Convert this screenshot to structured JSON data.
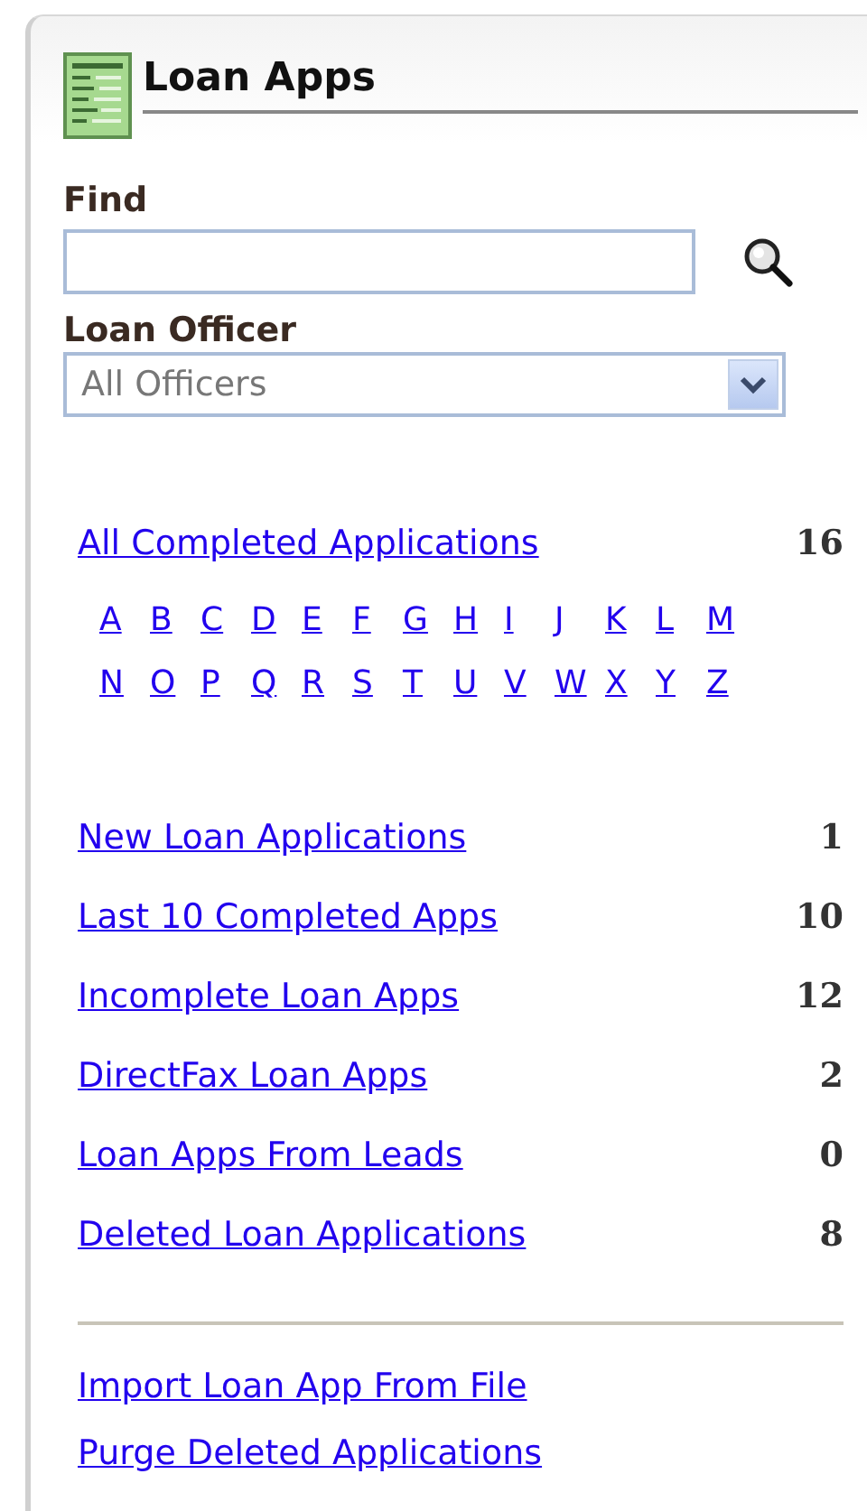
{
  "panel": {
    "title": "Loan Apps"
  },
  "find": {
    "label": "Find"
  },
  "loan_officer": {
    "label": "Loan Officer",
    "value": "All Officers"
  },
  "all_completed": {
    "label": "All Completed Applications",
    "count": "16"
  },
  "letters": [
    [
      "A",
      "B",
      "C",
      "D",
      "E",
      "F",
      "G",
      "H",
      "I",
      "J",
      "K",
      "L",
      "M"
    ],
    [
      "N",
      "O",
      "P",
      "Q",
      "R",
      "S",
      "T",
      "U",
      "V",
      "W",
      "X",
      "Y",
      "Z"
    ]
  ],
  "lists": [
    {
      "label": "New Loan Applications",
      "count": "1"
    },
    {
      "label": "Last 10 Completed Apps",
      "count": "10"
    },
    {
      "label": "Incomplete Loan Apps",
      "count": "12"
    },
    {
      "label": "DirectFax Loan Apps",
      "count": "2"
    },
    {
      "label": "Loan Apps From Leads",
      "count": "0"
    },
    {
      "label": "Deleted Loan Applications",
      "count": "8"
    }
  ],
  "actions": [
    "Import Loan App From File",
    "Purge Deleted Applications"
  ]
}
